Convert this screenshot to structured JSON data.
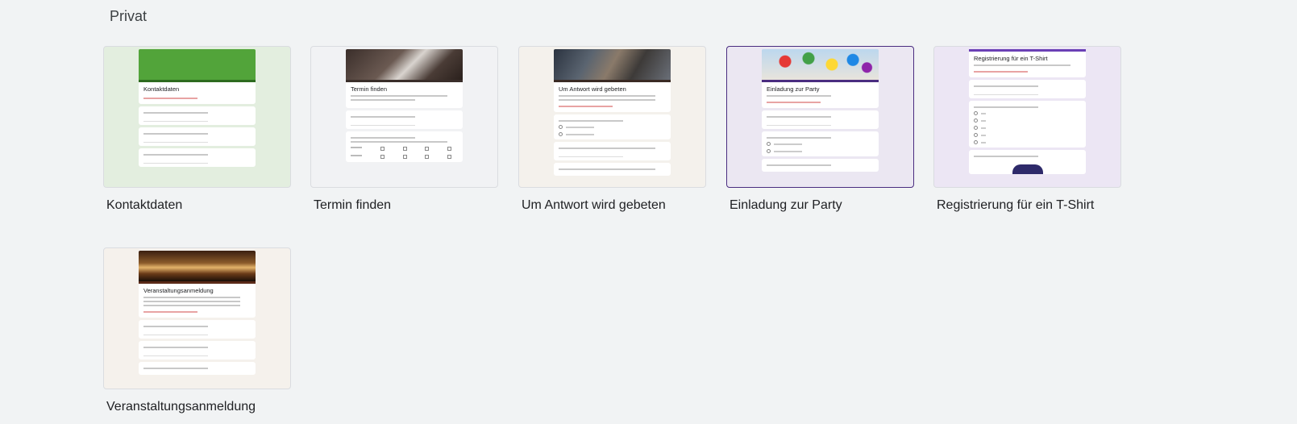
{
  "section": {
    "title": "Privat"
  },
  "templates": [
    {
      "title": "Kontaktdaten",
      "form_title": "Kontaktdaten"
    },
    {
      "title": "Termin finden",
      "form_title": "Termin finden"
    },
    {
      "title": "Um Antwort wird gebeten",
      "form_title": "Um Antwort wird gebeten"
    },
    {
      "title": "Einladung zur Party",
      "form_title": "Einladung zur Party"
    },
    {
      "title": "Registrierung für ein T-Shirt",
      "form_title": "Registrierung für ein T-Shirt"
    },
    {
      "title": "Veranstaltungsanmeldung",
      "form_title": "Veranstaltungsanmeldung"
    }
  ],
  "colors": {
    "page_background": "#f1f3f4",
    "selected_border": "#4a2d80",
    "kontaktdaten_bg": "#e3eedf",
    "termin_bg": "#f1f2f4",
    "antwort_bg": "#f4f1ec",
    "party_bg": "#ebe7f2",
    "tshirt_bg": "#ece6f4",
    "veranstaltung_bg": "#f5f1ec"
  }
}
